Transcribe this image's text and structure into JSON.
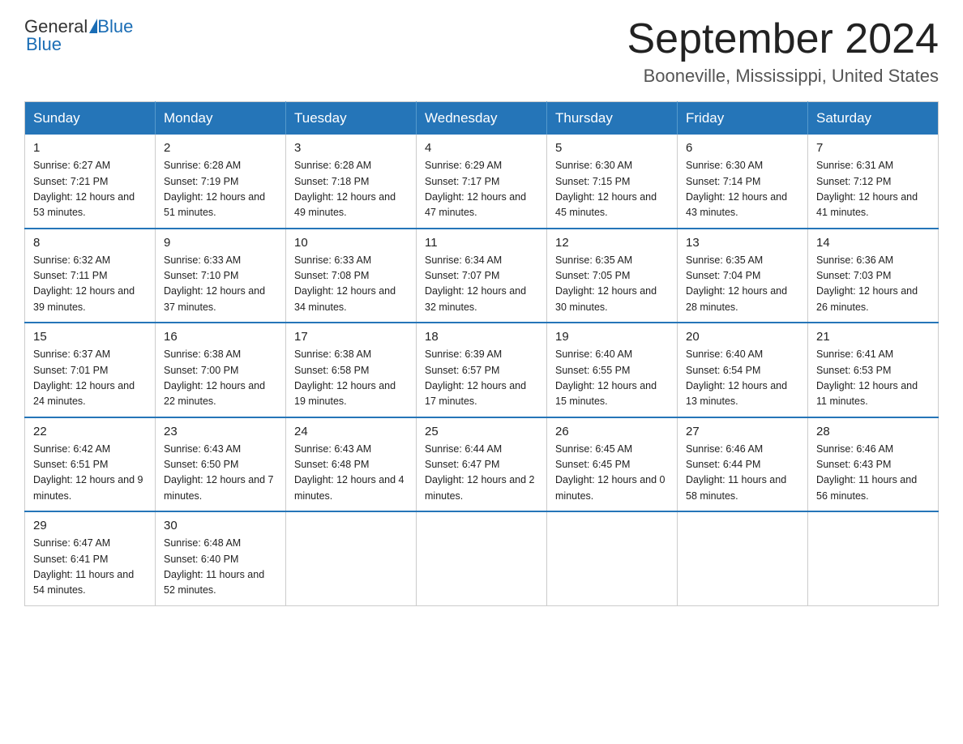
{
  "header": {
    "logo_general": "General",
    "logo_blue": "Blue",
    "month_title": "September 2024",
    "location": "Booneville, Mississippi, United States"
  },
  "weekdays": [
    "Sunday",
    "Monday",
    "Tuesday",
    "Wednesday",
    "Thursday",
    "Friday",
    "Saturday"
  ],
  "weeks": [
    [
      {
        "day": 1,
        "sunrise": "6:27 AM",
        "sunset": "7:21 PM",
        "daylight": "12 hours and 53 minutes"
      },
      {
        "day": 2,
        "sunrise": "6:28 AM",
        "sunset": "7:19 PM",
        "daylight": "12 hours and 51 minutes"
      },
      {
        "day": 3,
        "sunrise": "6:28 AM",
        "sunset": "7:18 PM",
        "daylight": "12 hours and 49 minutes"
      },
      {
        "day": 4,
        "sunrise": "6:29 AM",
        "sunset": "7:17 PM",
        "daylight": "12 hours and 47 minutes"
      },
      {
        "day": 5,
        "sunrise": "6:30 AM",
        "sunset": "7:15 PM",
        "daylight": "12 hours and 45 minutes"
      },
      {
        "day": 6,
        "sunrise": "6:30 AM",
        "sunset": "7:14 PM",
        "daylight": "12 hours and 43 minutes"
      },
      {
        "day": 7,
        "sunrise": "6:31 AM",
        "sunset": "7:12 PM",
        "daylight": "12 hours and 41 minutes"
      }
    ],
    [
      {
        "day": 8,
        "sunrise": "6:32 AM",
        "sunset": "7:11 PM",
        "daylight": "12 hours and 39 minutes"
      },
      {
        "day": 9,
        "sunrise": "6:33 AM",
        "sunset": "7:10 PM",
        "daylight": "12 hours and 37 minutes"
      },
      {
        "day": 10,
        "sunrise": "6:33 AM",
        "sunset": "7:08 PM",
        "daylight": "12 hours and 34 minutes"
      },
      {
        "day": 11,
        "sunrise": "6:34 AM",
        "sunset": "7:07 PM",
        "daylight": "12 hours and 32 minutes"
      },
      {
        "day": 12,
        "sunrise": "6:35 AM",
        "sunset": "7:05 PM",
        "daylight": "12 hours and 30 minutes"
      },
      {
        "day": 13,
        "sunrise": "6:35 AM",
        "sunset": "7:04 PM",
        "daylight": "12 hours and 28 minutes"
      },
      {
        "day": 14,
        "sunrise": "6:36 AM",
        "sunset": "7:03 PM",
        "daylight": "12 hours and 26 minutes"
      }
    ],
    [
      {
        "day": 15,
        "sunrise": "6:37 AM",
        "sunset": "7:01 PM",
        "daylight": "12 hours and 24 minutes"
      },
      {
        "day": 16,
        "sunrise": "6:38 AM",
        "sunset": "7:00 PM",
        "daylight": "12 hours and 22 minutes"
      },
      {
        "day": 17,
        "sunrise": "6:38 AM",
        "sunset": "6:58 PM",
        "daylight": "12 hours and 19 minutes"
      },
      {
        "day": 18,
        "sunrise": "6:39 AM",
        "sunset": "6:57 PM",
        "daylight": "12 hours and 17 minutes"
      },
      {
        "day": 19,
        "sunrise": "6:40 AM",
        "sunset": "6:55 PM",
        "daylight": "12 hours and 15 minutes"
      },
      {
        "day": 20,
        "sunrise": "6:40 AM",
        "sunset": "6:54 PM",
        "daylight": "12 hours and 13 minutes"
      },
      {
        "day": 21,
        "sunrise": "6:41 AM",
        "sunset": "6:53 PM",
        "daylight": "12 hours and 11 minutes"
      }
    ],
    [
      {
        "day": 22,
        "sunrise": "6:42 AM",
        "sunset": "6:51 PM",
        "daylight": "12 hours and 9 minutes"
      },
      {
        "day": 23,
        "sunrise": "6:43 AM",
        "sunset": "6:50 PM",
        "daylight": "12 hours and 7 minutes"
      },
      {
        "day": 24,
        "sunrise": "6:43 AM",
        "sunset": "6:48 PM",
        "daylight": "12 hours and 4 minutes"
      },
      {
        "day": 25,
        "sunrise": "6:44 AM",
        "sunset": "6:47 PM",
        "daylight": "12 hours and 2 minutes"
      },
      {
        "day": 26,
        "sunrise": "6:45 AM",
        "sunset": "6:45 PM",
        "daylight": "12 hours and 0 minutes"
      },
      {
        "day": 27,
        "sunrise": "6:46 AM",
        "sunset": "6:44 PM",
        "daylight": "11 hours and 58 minutes"
      },
      {
        "day": 28,
        "sunrise": "6:46 AM",
        "sunset": "6:43 PM",
        "daylight": "11 hours and 56 minutes"
      }
    ],
    [
      {
        "day": 29,
        "sunrise": "6:47 AM",
        "sunset": "6:41 PM",
        "daylight": "11 hours and 54 minutes"
      },
      {
        "day": 30,
        "sunrise": "6:48 AM",
        "sunset": "6:40 PM",
        "daylight": "11 hours and 52 minutes"
      },
      null,
      null,
      null,
      null,
      null
    ]
  ]
}
